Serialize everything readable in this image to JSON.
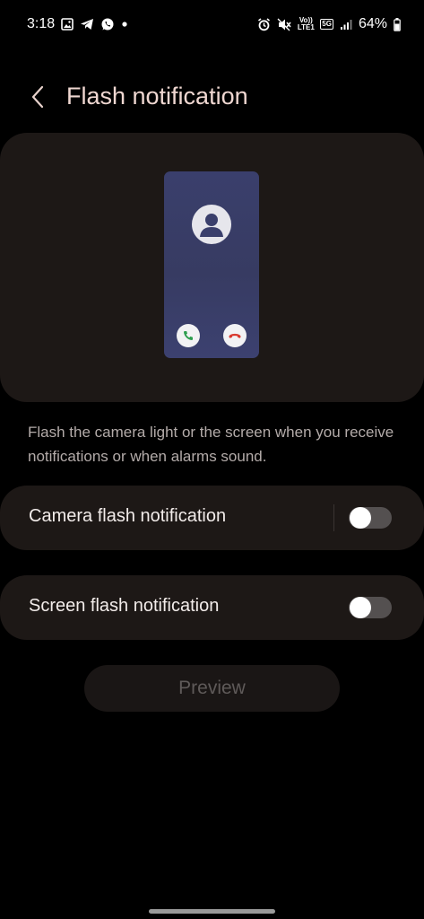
{
  "status_bar": {
    "time": "3:18",
    "volte_label": "Vo)) LTE1",
    "network_label": "5G",
    "battery_text": "64%"
  },
  "header": {
    "title": "Flash notification"
  },
  "description": "Flash the camera light or the screen when you receive notifications or when alarms sound.",
  "settings": [
    {
      "label": "Camera flash notification",
      "enabled": false
    },
    {
      "label": "Screen flash notification",
      "enabled": false
    }
  ],
  "preview_button": {
    "label": "Preview"
  },
  "colors": {
    "background": "#000000",
    "card": "#1d1816",
    "title": "#efd7d1",
    "phone_preview": "#3a3f6c",
    "accept_call": "#2e9e4f",
    "decline_call": "#d93a2f"
  }
}
